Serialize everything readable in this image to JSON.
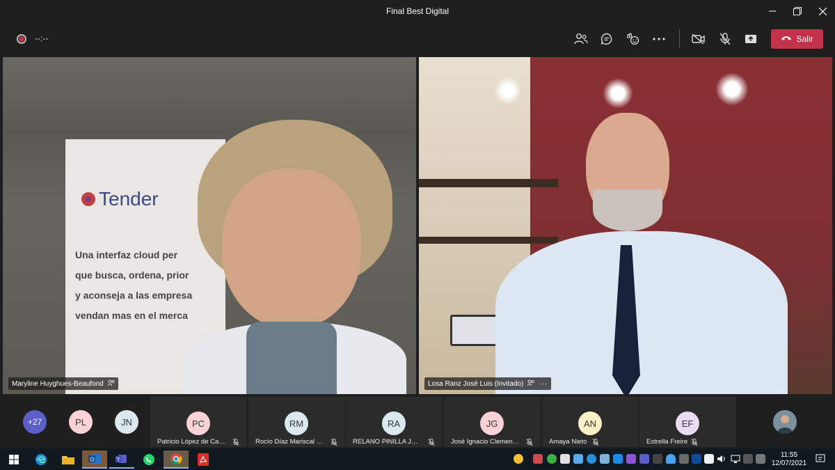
{
  "window": {
    "title": "Final Best Digital"
  },
  "toolbar": {
    "timer": "--:--",
    "leave_label": "Salir"
  },
  "tiles": [
    {
      "name": "Maryline Huyghues-Beaufond",
      "banner_brand": "Tender",
      "banner_text": [
        "Una interfaz cloud per",
        "que busca, ordena, prior",
        "y aconseja a las empresa",
        "vendan mas en el merca"
      ]
    },
    {
      "name": "Losa Ranz José Luis (Invitado)"
    }
  ],
  "strip": {
    "overflow": "+27",
    "avatars": [
      {
        "initials": "PL",
        "color": "#fbd3d6"
      },
      {
        "initials": "JN",
        "color": "#dbe9ef"
      }
    ],
    "cards": [
      {
        "initials": "PC",
        "color": "#fbd3d6",
        "name": "Patricio López de Carri..."
      },
      {
        "initials": "RM",
        "color": "#dbe9ef",
        "name": "Rocío Díaz Mariscal (I..."
      },
      {
        "initials": "RA",
        "color": "#dbe9ef",
        "name": "RELANO PINILLA JUA..."
      },
      {
        "initials": "JG",
        "color": "#fbd3d6",
        "name": "José Ignacio Clemente..."
      },
      {
        "initials": "AN",
        "color": "#fdf0c4",
        "name": "Amaya Nieto"
      },
      {
        "initials": "EF",
        "color": "#e9dcf3",
        "name": "Estrella Freire"
      }
    ]
  },
  "taskbar": {
    "time": "11:55",
    "date": "12/07/2021"
  }
}
